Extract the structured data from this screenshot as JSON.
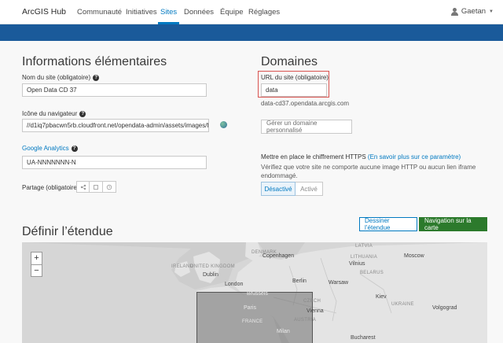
{
  "nav": {
    "brand": "ArcGIS Hub",
    "items": [
      {
        "label": "Communauté",
        "active": false
      },
      {
        "label": "Initiatives",
        "active": false
      },
      {
        "label": "Sites",
        "active": true
      },
      {
        "label": "Données",
        "active": false
      },
      {
        "label": "Équipe",
        "active": false
      },
      {
        "label": "Réglages",
        "active": false
      }
    ],
    "user": "Gaetan"
  },
  "colors": {
    "accent": "#0079c1",
    "banner": "#1a5a9a",
    "highlight": "#d9534f",
    "primary_button": "#2c7a2c"
  },
  "basic_info": {
    "title": "Informations élémentaires",
    "site_name_label": "Nom du site (obligatoire)",
    "site_name_value": "Open Data CD 37",
    "favicon_label": "Icône du navigateur",
    "favicon_value": "//d1iq7pbacwn5rb.cloudfront.net/opendata-admin/assets/images/f",
    "analytics_label": "Google Analytics",
    "analytics_value": "UA-NNNNNNN-N",
    "share_label": "Partage (obligatoire)",
    "share_icons": [
      "share-icon",
      "bookmark-icon",
      "clock-icon"
    ]
  },
  "domains": {
    "title": "Domaines",
    "url_label": "URL du site (obligatoire)",
    "url_value": "data",
    "url_full": "data-cd37.opendata.arcgis.com",
    "custom_domain_button": "Gérer un domaine personnalisé",
    "https_label": "Mettre en place le chiffrement HTTPS",
    "https_link": "(En savoir plus sur ce paramètre)",
    "https_note": "Vérifiez que votre site ne comporte aucune image HTTP ou aucun lien iframe endommagé.",
    "toggle_off": "Désactivé",
    "toggle_on": "Activé",
    "toggle_selected": "Désactivé"
  },
  "extent": {
    "title": "Définir l’étendue",
    "draw_button": "Dessiner l’étendue",
    "navigate_button": "Navigation sur la carte",
    "zoom_in": "+",
    "zoom_out": "−",
    "places": {
      "latvia": "LATVIA",
      "copenhagen": "Copenhagen",
      "moscow": "Moscow",
      "lithuania": "LITHUANIA",
      "vilnius": "Vilnius",
      "dublin": "Dublin",
      "london": "London",
      "berlin": "Berlin",
      "warsaw": "Warsaw",
      "brussels": "Brussels",
      "kiev": "Kiev",
      "czech": "CZECH",
      "paris": "Paris",
      "vienna": "Vienna",
      "austria": "AUSTRIA",
      "france": "FRANCE",
      "volgograd": "Volgograd",
      "milan": "Milan",
      "bucharest": "Bucharest",
      "denmark": "DENMARK",
      "belarus": "BELARUS",
      "ukraine": "UKRAINE",
      "ireland": "IRELAND",
      "uk": "UNITED KINGDOM"
    }
  }
}
